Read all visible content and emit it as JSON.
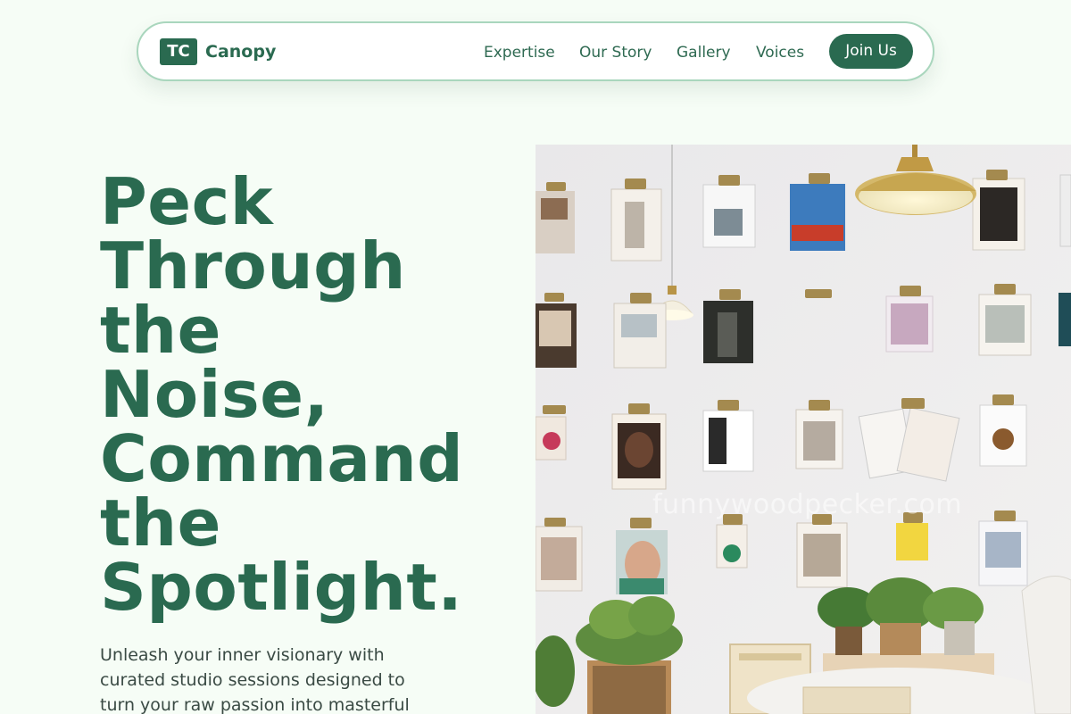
{
  "brand": {
    "badge": "TC",
    "name": "Canopy"
  },
  "nav": {
    "links": [
      "Expertise",
      "Our Story",
      "Gallery",
      "Voices"
    ],
    "cta": "Join Us"
  },
  "hero": {
    "title_lines": [
      "Peck",
      "Through",
      "the",
      "Noise,",
      "Command",
      "the",
      "Spotlight."
    ],
    "subtitle_lines": [
      "Unleash your inner visionary with",
      "curated studio sessions designed to",
      "turn your raw passion into masterful"
    ],
    "image_watermark": "funnywoodpecker.com"
  },
  "colors": {
    "background": "#f6fdf6",
    "brand_green": "#2a6a50",
    "nav_border": "#a9d6bd"
  },
  "icons": {
    "logo": "tc-badge"
  }
}
